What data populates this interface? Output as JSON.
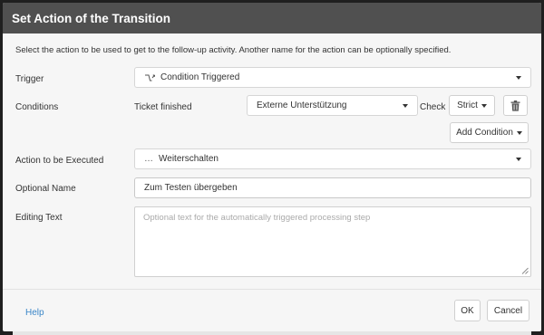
{
  "dialog": {
    "title": "Set Action of the Transition",
    "intro": "Select the action to be used to get to the follow-up activity. Another name for the action can be optionally specified."
  },
  "trigger": {
    "label": "Trigger",
    "value": "Condition Triggered",
    "icon": "condition-trigger-icon"
  },
  "conditions": {
    "label": "Conditions",
    "subject": "Ticket finished",
    "value": "Externe Unterstützung",
    "check_label": "Check",
    "check_value": "Strict",
    "add_condition_label": "Add Condition",
    "delete_icon": "trash-icon"
  },
  "action": {
    "label": "Action to be Executed",
    "value": "Weiterschalten",
    "icon": "ellipsis-icon"
  },
  "optional_name": {
    "label": "Optional Name",
    "value": "Zum Testen übergeben"
  },
  "editing_text": {
    "label": "Editing Text",
    "placeholder": "Optional text for the automatically triggered processing step"
  },
  "footer": {
    "help_label": "Help",
    "ok_label": "OK",
    "cancel_label": "Cancel"
  },
  "colors": {
    "titlebar": "#505050",
    "dialog_bg": "#f6f6f6",
    "link": "#3a86c8",
    "backdrop": "#1f1f1f"
  }
}
